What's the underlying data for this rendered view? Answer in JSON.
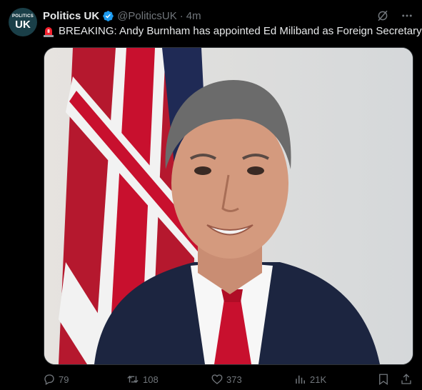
{
  "post": {
    "author_name": "Politics UK",
    "handle": "@PoliticsUK",
    "separator": "·",
    "time": "4m",
    "avatar_line1": "POLITICS",
    "avatar_line2": "UK",
    "text": "BREAKING: Andy Burnham has appointed Ed Miliband as Foreign Secretary",
    "emoji": "rotating-light-icon"
  },
  "media": {
    "subject": "photo of man in dark suit and red tie in front of Union Jack flag"
  },
  "actions": {
    "replies": "79",
    "reposts": "108",
    "likes": "373",
    "views": "21K"
  },
  "colors": {
    "background": "#000000",
    "text": "#e7e9ea",
    "secondary": "#71767b",
    "verified": "#1d9bf0",
    "siren": "#f4212e"
  }
}
